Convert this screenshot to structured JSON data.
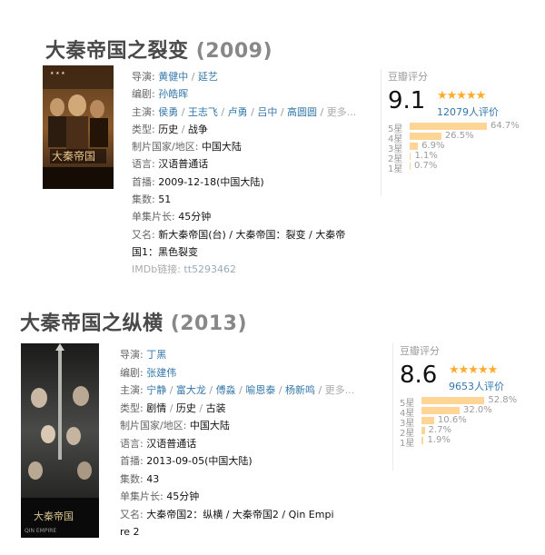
{
  "movies": [
    {
      "title": "大秦帝国之裂变",
      "year": "(2009)",
      "info": {
        "director_label": "导演:",
        "directors": [
          "黄健中",
          "延艺"
        ],
        "writer_label": "编剧:",
        "writers": [
          "孙皓晖"
        ],
        "cast_label": "主演:",
        "cast": [
          "侯勇",
          "王志飞",
          "卢勇",
          "吕中",
          "高圆圆"
        ],
        "more": "更多...",
        "genre_label": "类型:",
        "genres": [
          "历史",
          "战争"
        ],
        "country_label": "制片国家/地区:",
        "country": "中国大陆",
        "language_label": "语言:",
        "language": "汉语普通话",
        "release_label": "首播:",
        "release": "2009-12-18(中国大陆)",
        "episodes_label": "集数:",
        "episodes": "51",
        "runtime_label": "单集片长:",
        "runtime": "45分钟",
        "aka_label": "又名:",
        "aka_line1": "新大秦帝国(台) / 大秦帝国：裂变 / 大秦帝",
        "aka_line2": "国1：黑色裂变",
        "imdb_label": "IMDb链接:",
        "imdb": "tt5293462"
      },
      "rating": {
        "label": "豆瓣评分",
        "score": "9.1",
        "stars": "★★★★★",
        "votes": "12079人评价",
        "distribution": [
          {
            "label": "5星",
            "value": 64.7,
            "text": "64.7%"
          },
          {
            "label": "4星",
            "value": 26.5,
            "text": "26.5%"
          },
          {
            "label": "3星",
            "value": 6.9,
            "text": "6.9%"
          },
          {
            "label": "2星",
            "value": 1.1,
            "text": "1.1%"
          },
          {
            "label": "1星",
            "value": 0.7,
            "text": "0.7%"
          }
        ]
      },
      "poster_text": [
        "你大秦帝国",
        "大秦帝国"
      ]
    },
    {
      "title": "大秦帝国之纵横",
      "year": "(2013)",
      "info": {
        "director_label": "导演:",
        "directors": [
          "丁黑"
        ],
        "writer_label": "编剧:",
        "writers": [
          "张建伟"
        ],
        "cast_label": "主演:",
        "cast": [
          "宁静",
          "富大龙",
          "傅淼",
          "喻恩泰",
          "杨新鸣"
        ],
        "more": "更多...",
        "genre_label": "类型:",
        "genres": [
          "剧情",
          "历史",
          "古装"
        ],
        "country_label": "制片国家/地区:",
        "country": "中国大陆",
        "language_label": "语言:",
        "language": "汉语普通话",
        "release_label": "首播:",
        "release": "2013-09-05(中国大陆)",
        "episodes_label": "集数:",
        "episodes": "43",
        "runtime_label": "单集片长:",
        "runtime": "45分钟",
        "aka_label": "又名:",
        "aka_line1": "大秦帝国2：纵横 / 大秦帝国2 / Qin Empi",
        "aka_line2": "re 2"
      },
      "rating": {
        "label": "豆瓣评分",
        "score": "8.6",
        "stars": "★★★★★",
        "votes": "9653人评价",
        "distribution": [
          {
            "label": "5星",
            "value": 52.8,
            "text": "52.8%"
          },
          {
            "label": "4星",
            "value": 32.0,
            "text": "32.0%"
          },
          {
            "label": "3星",
            "value": 10.6,
            "text": "10.6%"
          },
          {
            "label": "2星",
            "value": 2.7,
            "text": "2.7%"
          },
          {
            "label": "1星",
            "value": 1.9,
            "text": "1.9%"
          }
        ]
      }
    }
  ]
}
